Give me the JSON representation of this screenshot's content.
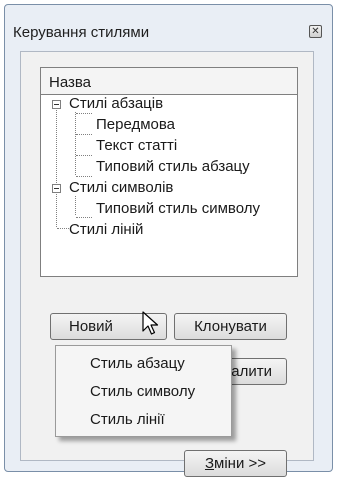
{
  "dialog": {
    "title": "Керування стилями",
    "close_icon": "close-icon"
  },
  "list": {
    "header": "Назва",
    "groups": [
      {
        "label": "Стилі абзаців",
        "children": [
          "Передмова",
          "Текст статті",
          "Типовий стиль абзацу"
        ]
      },
      {
        "label": "Стилі символів",
        "children": [
          "Типовий стиль символу"
        ]
      }
    ],
    "lines_item": "Стилі ліній"
  },
  "buttons": {
    "new": "Новий",
    "new_arrow": "▾",
    "clone": "Клонувати",
    "delete_partial": "алити",
    "changes_accel": "З",
    "changes_rest": "міни >>"
  },
  "dropdown": {
    "items": [
      "Стиль абзацу",
      "Стиль символу",
      "Стиль лінії"
    ]
  }
}
